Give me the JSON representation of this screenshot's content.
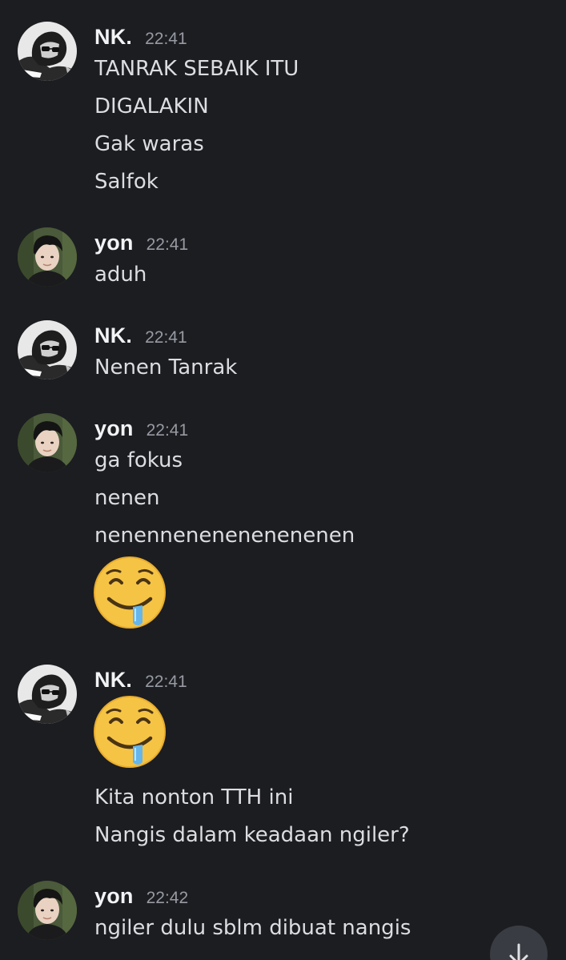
{
  "messages": [
    {
      "author": "NK.",
      "time": "22:41",
      "avatar_icon": "avatar-nk",
      "lines": [
        "TANRAK SEBAIK ITU",
        "DIGALAKIN",
        "Gak waras",
        "Salfok"
      ]
    },
    {
      "author": "yon",
      "time": "22:41",
      "avatar_icon": "avatar-yon",
      "lines": [
        "aduh"
      ]
    },
    {
      "author": "NK.",
      "time": "22:41",
      "avatar_icon": "avatar-nk",
      "lines": [
        "Nenen Tanrak"
      ]
    },
    {
      "author": "yon",
      "time": "22:41",
      "avatar_icon": "avatar-yon",
      "lines": [
        "ga fokus",
        "nenen",
        "nenennenenenenenenen"
      ],
      "emoji": "drooling-smile-emoji"
    },
    {
      "author": "NK.",
      "time": "22:41",
      "avatar_icon": "avatar-nk",
      "emoji": "drooling-smile-emoji",
      "lines": [
        "Kita nonton TTH ini",
        "Nangis dalam keadaan ngiler?"
      ]
    },
    {
      "author": "yon",
      "time": "22:42",
      "avatar_icon": "avatar-yon",
      "lines": [
        "ngiler dulu sblm dibuat nangis"
      ]
    }
  ],
  "scroll_button": {
    "icon": "arrow-down-icon"
  },
  "colors": {
    "background": "#1c1d21",
    "author": "#f2f3f5",
    "timestamp": "#979aa3",
    "message_text": "#dcdde1",
    "scroll_button": "#3a3c43"
  }
}
